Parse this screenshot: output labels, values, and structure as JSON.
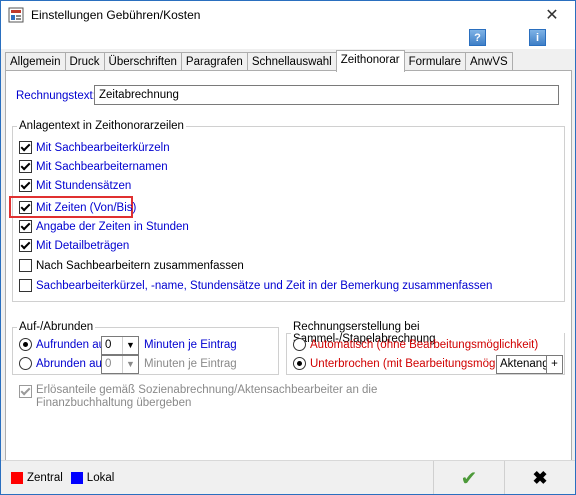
{
  "window": {
    "title": "Einstellungen Gebühren/Kosten",
    "close_glyph": "✕",
    "help_glyph": "?",
    "info_glyph": "i"
  },
  "tabs": [
    {
      "label": "Allgemein",
      "active": false
    },
    {
      "label": "Druck",
      "active": false
    },
    {
      "label": "Überschriften",
      "active": false
    },
    {
      "label": "Paragrafen",
      "active": false
    },
    {
      "label": "Schnellauswahl",
      "active": false
    },
    {
      "label": "Zeithonorar",
      "active": true
    },
    {
      "label": "Formulare",
      "active": false
    },
    {
      "label": "AnwVS",
      "active": false
    }
  ],
  "rechnungstext": {
    "label": "Rechnungstext:",
    "value": "Zeitabrechnung"
  },
  "anlagentext": {
    "legend": "Anlagentext in Zeithonorarzeilen",
    "items": [
      {
        "label": "Mit Sachbearbeiterkürzeln",
        "checked": true,
        "color": "blue"
      },
      {
        "label": "Mit Sachbearbeiternamen",
        "checked": true,
        "color": "blue"
      },
      {
        "label": "Mit Stundensätzen",
        "checked": true,
        "color": "blue"
      },
      {
        "label": "Mit Zeiten (Von/Bis)",
        "checked": true,
        "color": "blue"
      },
      {
        "label": "Angabe der Zeiten in Stunden",
        "checked": true,
        "color": "blue"
      },
      {
        "label": "Mit Detailbeträgen",
        "checked": true,
        "color": "blue"
      },
      {
        "label": "Nach Sachbearbeitern zusammenfassen",
        "checked": false,
        "color": "black"
      },
      {
        "label": "Sachbearbeiterkürzel, -name, Stundensätze und Zeit in der Bemerkung zusammenfassen",
        "checked": false,
        "color": "blue"
      }
    ]
  },
  "rundung": {
    "legend": "Auf-/Abrunden",
    "aufrunden_label": "Aufrunden auf",
    "aufrunden_value": "0",
    "aufrunden_unit": "Minuten je Eintrag",
    "abrunden_label": "Abrunden auf",
    "abrunden_value": "0",
    "abrunden_unit": "Minuten je Eintrag",
    "selected": "aufrunden"
  },
  "rechnungserstellung": {
    "legend": "Rechnungserstellung bei Sammel-/Stapelabrechnung",
    "automatisch_label": "Automatisch (ohne Bearbeitungsmöglichkeit)",
    "unterbrochen_label": "Unterbrochen (mit Bearbeitungsmöglichkeit)",
    "selected": "unterbrochen",
    "sort_value": "Aktenangabe",
    "plus_label": "+"
  },
  "erloes": {
    "line1": "Erlösanteile gemäß Sozienabrechnung/Aktensachbearbeiter an die",
    "line2": "Finanzbuchhaltung übergeben",
    "checked": true,
    "disabled": true
  },
  "footer": {
    "zentral_label": "Zentral",
    "lokal_label": "Lokal",
    "zentral_color": "#ff0000",
    "lokal_color": "#0000ff",
    "ok_glyph": "✔",
    "cancel_glyph": "✖"
  },
  "colors": {
    "blue_text": "#0000d0",
    "red_text": "#d00000",
    "highlight_border": "#e03030"
  }
}
